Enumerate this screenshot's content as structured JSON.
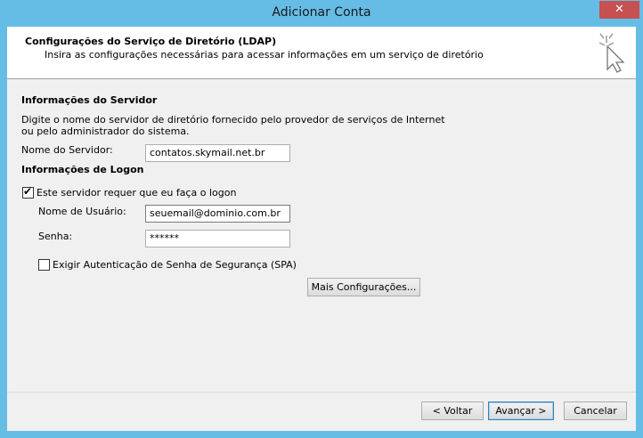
{
  "window": {
    "title": "Adicionar Conta",
    "close_glyph": "✕"
  },
  "header": {
    "title": "Configurações do Serviço de Diretório (LDAP)",
    "subtitle": "Insira as configurações necessárias para acessar informações em um serviço de diretório"
  },
  "server": {
    "section_label": "Informações do Servidor",
    "description_line1": "Digite o nome do servidor de diretório fornecido pelo provedor de serviços de Internet",
    "description_line2": "ou pelo administrador do sistema.",
    "server_name_label": "Nome do Servidor:",
    "server_name_value": "contatos.skymail.net.br"
  },
  "logon": {
    "section_label": "Informações de Logon",
    "require_logon_label": "Este servidor requer que eu faça o logon",
    "require_logon_checked": true,
    "username_label": "Nome de Usuário:",
    "username_value": "seuemail@dominio.com.br",
    "password_label": "Senha:",
    "password_value": "******",
    "spa_label": "Exigir Autenticação de Senha de Segurança (SPA)",
    "spa_checked": false,
    "more_settings_label": "Mais Configurações..."
  },
  "footer": {
    "back_label": "< Voltar",
    "next_label": "Avançar >",
    "cancel_label": "Cancelar"
  }
}
